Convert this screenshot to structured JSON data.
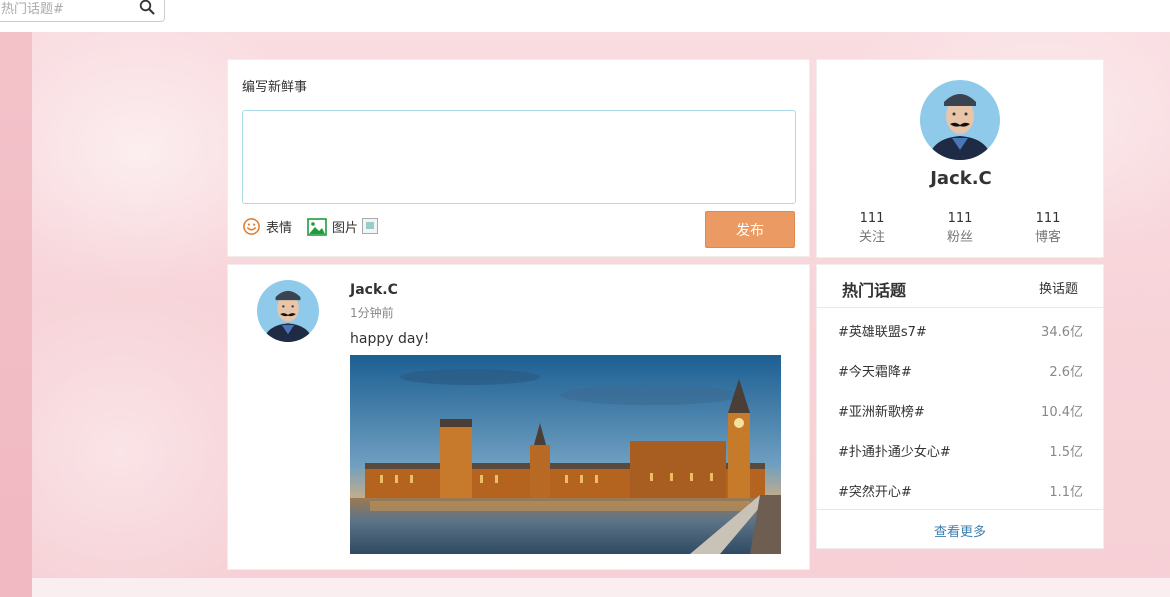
{
  "search": {
    "placeholder": "热门话题#"
  },
  "compose": {
    "title": "编写新鲜事",
    "emoji_label": "表情",
    "image_label": "图片",
    "publish_label": "发布"
  },
  "profile": {
    "name": "Jack.C",
    "stats": [
      {
        "value": "111",
        "label": "关注"
      },
      {
        "value": "111",
        "label": "粉丝"
      },
      {
        "value": "111",
        "label": "博客"
      }
    ]
  },
  "post": {
    "author": "Jack.C",
    "time": "1分钟前",
    "text": "happy day!"
  },
  "topics": {
    "title": "热门话题",
    "change_label": "换话题",
    "items": [
      {
        "name": "#英雄联盟s7#",
        "count": "34.6亿"
      },
      {
        "name": "#今天霜降#",
        "count": "2.6亿"
      },
      {
        "name": "#亚洲新歌榜#",
        "count": "10.4亿"
      },
      {
        "name": "#扑通扑通少女心#",
        "count": "1.5亿"
      },
      {
        "name": "#突然开心#",
        "count": "1.1亿"
      }
    ],
    "more_label": "查看更多"
  },
  "colors": {
    "accent": "#ec9a63",
    "link": "#3a7fb0",
    "background_pink": "#f7d3d8"
  }
}
